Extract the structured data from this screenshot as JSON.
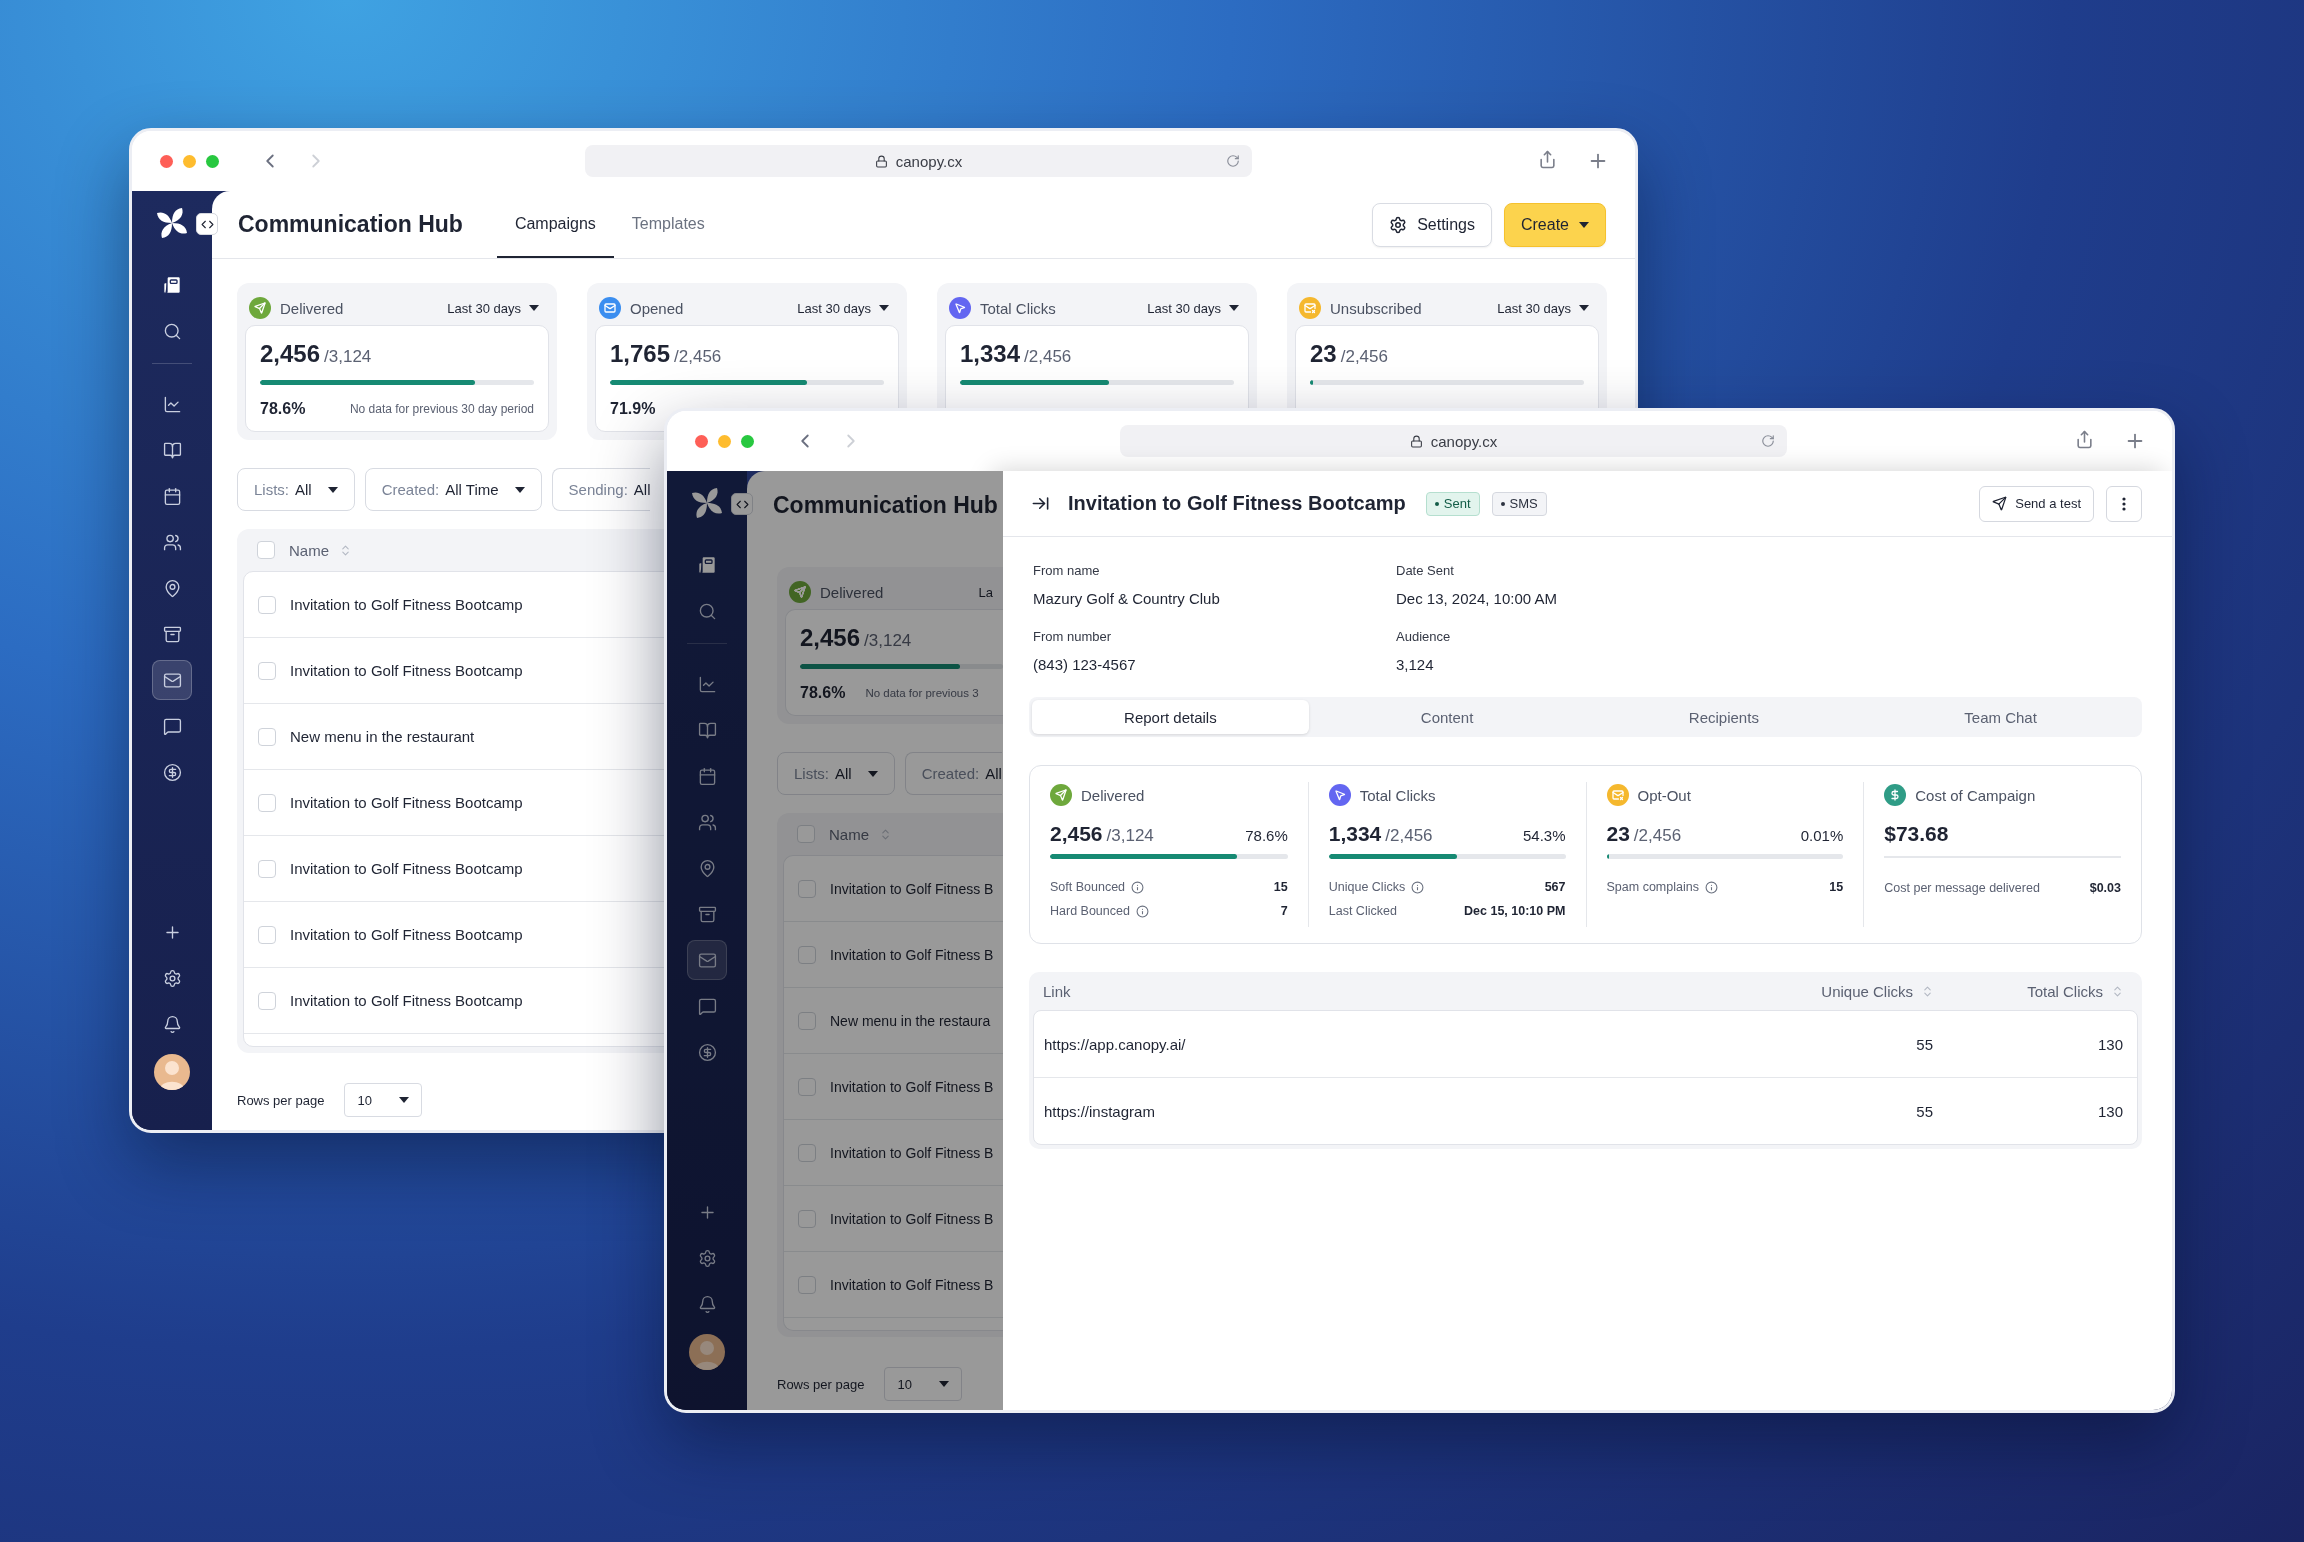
{
  "back_window": {
    "address": "canopy.cx",
    "can_go_forward": false,
    "sidebar": {
      "groups": [
        {
          "items": [
            {
              "kind": "app",
              "selected": false
            },
            {
              "kind": "search",
              "selected": false
            }
          ]
        },
        {
          "items": [
            {
              "kind": "chart",
              "selected": false
            },
            {
              "kind": "notebook",
              "selected": false
            },
            {
              "kind": "calendar",
              "selected": false
            },
            {
              "kind": "contacts",
              "selected": false
            },
            {
              "kind": "location",
              "selected": false
            },
            {
              "kind": "archive",
              "selected": false
            },
            {
              "kind": "mail",
              "selected": true
            },
            {
              "kind": "chat",
              "selected": false
            },
            {
              "kind": "billing",
              "selected": false
            }
          ]
        }
      ],
      "bottom_items": [
        {
          "kind": "add"
        },
        {
          "kind": "settings"
        },
        {
          "kind": "notifications"
        }
      ]
    },
    "header": {
      "title": "Communication Hub",
      "tabs": [
        {
          "label": "Campaigns",
          "selected": true
        },
        {
          "label": "Templates",
          "selected": false
        }
      ],
      "actions": [
        {
          "label": "Settings",
          "kind": "settings"
        },
        {
          "label": "Create",
          "kind": "create"
        }
      ]
    },
    "stats": [
      {
        "kind": "delivered",
        "label": "Delivered",
        "color": "#6ea83c",
        "period": "Last 30 days",
        "value": "2,456",
        "total": "/3,124",
        "level": 0.786,
        "percent": "78.6%",
        "note": "No data for previous 30 day period"
      },
      {
        "kind": "opened",
        "label": "Opened",
        "color": "#3b8ef0",
        "period": "Last 30 days",
        "value": "1,765",
        "total": "/2,456",
        "level": 0.719,
        "percent": "71.9%"
      },
      {
        "kind": "clicks",
        "label": "Total Clicks",
        "color": "#6366f1",
        "period": "Last 30 days",
        "value": "1,334",
        "total": "/2,456",
        "level": 0.543
      },
      {
        "kind": "unsubscribed",
        "label": "Unsubscribed",
        "color": "#f5b82e",
        "period": "Last 30 days",
        "value": "23",
        "total": "/2,456",
        "level": 0.01
      }
    ],
    "filters": [
      {
        "label": "Lists:",
        "value": "All"
      },
      {
        "label": "Created:",
        "value": "All Time"
      },
      {
        "label": "Sending:",
        "value": "All"
      }
    ],
    "table": {
      "columns": [
        {
          "label": "Name",
          "sortable": true
        }
      ],
      "all_checked": false,
      "rows": [
        {
          "name": "Invitation to Golf Fitness Bootcamp",
          "checked": false
        },
        {
          "name": "Invitation to Golf Fitness Bootcamp",
          "checked": false
        },
        {
          "name": "New menu in the restaurant",
          "checked": false
        },
        {
          "name": "Invitation to Golf Fitness Bootcamp",
          "checked": false
        },
        {
          "name": "Invitation to Golf Fitness Bootcamp",
          "checked": false
        },
        {
          "name": "Invitation to Golf Fitness Bootcamp",
          "checked": false
        },
        {
          "name": "Invitation to Golf Fitness Bootcamp",
          "checked": false
        }
      ]
    },
    "pagination": {
      "label": "Rows per page",
      "value": "10"
    }
  },
  "front_window": {
    "address": "canopy.cx",
    "can_go_forward": false,
    "sidebar": {
      "groups": [
        {
          "items": [
            {
              "kind": "app",
              "selected": false
            },
            {
              "kind": "search",
              "selected": false
            }
          ]
        },
        {
          "items": [
            {
              "kind": "chart",
              "selected": false
            },
            {
              "kind": "notebook",
              "selected": false
            },
            {
              "kind": "calendar",
              "selected": false
            },
            {
              "kind": "contacts",
              "selected": false
            },
            {
              "kind": "location",
              "selected": false
            },
            {
              "kind": "archive",
              "selected": false
            },
            {
              "kind": "mail",
              "selected": true
            },
            {
              "kind": "chat",
              "selected": false
            },
            {
              "kind": "billing",
              "selected": false
            }
          ]
        }
      ],
      "bottom_items": [
        {
          "kind": "add"
        },
        {
          "kind": "settings"
        },
        {
          "kind": "notifications"
        }
      ]
    },
    "backdrop": {
      "title": "Communication Hub",
      "stat": {
        "kind": "delivered",
        "label": "Delivered",
        "color": "#426524",
        "period": "La",
        "value": "2,456",
        "total": "/3,124",
        "level": 0.786,
        "percent": "78.6%",
        "note": "No data for previous 3"
      },
      "filters": [
        {
          "label": "Lists:",
          "value": "All"
        },
        {
          "label": "Created:",
          "value": "All"
        }
      ],
      "table": {
        "columns": [
          {
            "label": "Name",
            "sortable": true
          }
        ],
        "all_checked": false,
        "rows": [
          {
            "name": "Invitation to Golf Fitness B",
            "checked": false
          },
          {
            "name": "Invitation to Golf Fitness B",
            "checked": false
          },
          {
            "name": "New menu in the restaura",
            "checked": false
          },
          {
            "name": "Invitation to Golf Fitness B",
            "checked": false
          },
          {
            "name": "Invitation to Golf Fitness B",
            "checked": false
          },
          {
            "name": "Invitation to Golf Fitness B",
            "checked": false
          },
          {
            "name": "Invitation to Golf Fitness B",
            "checked": false
          }
        ]
      },
      "pagination": {
        "label": "Rows per page",
        "value": "10"
      }
    },
    "panel": {
      "title": "Invitation to Golf Fitness Bootcamp",
      "badges": [
        {
          "label": "Sent",
          "kind": "success"
        },
        {
          "label": "SMS",
          "kind": "neutral"
        }
      ],
      "send_test": "Send a test",
      "fields": [
        {
          "label": "From name",
          "value": "Mazury Golf & Country Club"
        },
        {
          "label": "Date Sent",
          "value": "Dec 13, 2024, 10:00 AM"
        },
        {
          "label": "From number",
          "value": "(843) 123-4567"
        },
        {
          "label": "Audience",
          "value": "3,124"
        }
      ],
      "tabs": [
        {
          "label": "Report details",
          "selected": true
        },
        {
          "label": "Content",
          "selected": false
        },
        {
          "label": "Recipients",
          "selected": false
        },
        {
          "label": "Team Chat",
          "selected": false
        }
      ],
      "metrics": [
        {
          "kind": "delivered",
          "label": "Delivered",
          "color": "#6ea83c",
          "value": "2,456",
          "total": "/3,124",
          "percent": "78.6%",
          "level": 0.786,
          "details": [
            {
              "label": "Soft Bounced",
              "info": true,
              "value": "15"
            },
            {
              "label": "Hard Bounced",
              "info": true,
              "value": "7"
            }
          ]
        },
        {
          "kind": "clicks",
          "label": "Total Clicks",
          "color": "#6366f1",
          "value": "1,334",
          "total": "/2,456",
          "percent": "54.3%",
          "level": 0.543,
          "details": [
            {
              "label": "Unique Clicks",
              "info": true,
              "value": "567"
            },
            {
              "label": "Last Clicked",
              "info": false,
              "value": "Dec 15, 10:10 PM"
            }
          ]
        },
        {
          "kind": "unsubscribed",
          "label": "Opt-Out",
          "color": "#f5b82e",
          "value": "23",
          "total": "/2,456",
          "percent": "0.01%",
          "level": 0.01,
          "details": [
            {
              "label": "Spam complains",
              "info": true,
              "value": "15"
            }
          ]
        },
        {
          "kind": "cost",
          "label": "Cost of Campaign",
          "color": "#2f9c86",
          "value": "$73.68",
          "details": [
            {
              "label": "Cost per message delivered",
              "info": false,
              "value": "$0.03"
            }
          ]
        }
      ],
      "links": {
        "columns": [
          {
            "label": "Link",
            "sortable": false
          },
          {
            "label": "Unique Clicks",
            "sortable": true
          },
          {
            "label": "Total Clicks",
            "sortable": true
          }
        ],
        "rows": [
          {
            "link": "https://app.canopy.ai/",
            "unique_clicks": "55",
            "total_clicks": "130"
          },
          {
            "link": "https://instagram",
            "unique_clicks": "55",
            "total_clicks": "130"
          }
        ]
      }
    }
  }
}
